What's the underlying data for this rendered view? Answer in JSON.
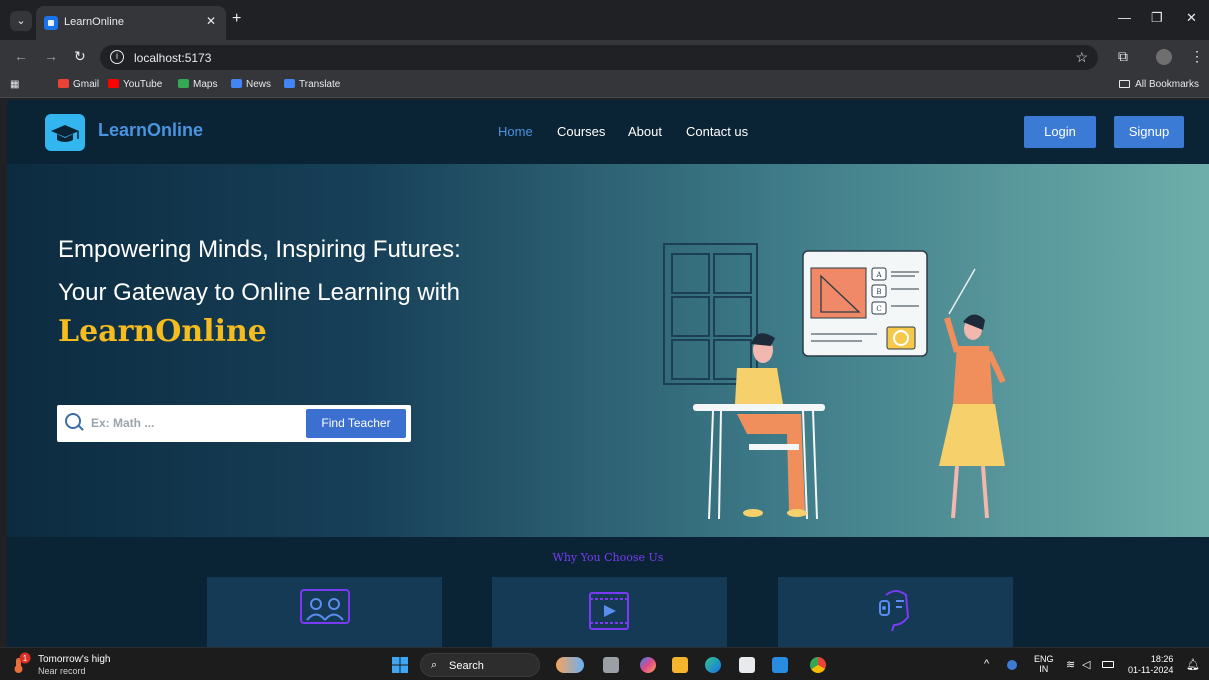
{
  "browser": {
    "tab_title": "LearnOnline",
    "tab_close": "✕",
    "new_tab": "+",
    "url": "localhost:5173",
    "bookmarks": [
      "Gmail",
      "YouTube",
      "Maps",
      "News",
      "Translate"
    ],
    "all_bookmarks": "All Bookmarks"
  },
  "site": {
    "brand": "LearnOnline",
    "nav": [
      "Home",
      "Courses",
      "About",
      "Contact us"
    ],
    "active_nav": "Home",
    "login": "Login",
    "signup": "Signup"
  },
  "hero": {
    "line1": "Empowering Minds, Inspiring Futures:",
    "line2": "Your Gateway to Online Learning with",
    "brand": "LearnOnline",
    "search_placeholder": "Ex: Math ...",
    "find_button": "Find Teacher",
    "board_options": [
      "A",
      "B",
      "C"
    ]
  },
  "why": {
    "title": "Why You Choose Us"
  },
  "taskbar": {
    "weather_line1": "Tomorrow's high",
    "weather_line2": "Near record",
    "weather_badge": "1",
    "search": "Search",
    "lang_line1": "ENG",
    "lang_line2": "IN",
    "time": "18:26",
    "date": "01-11-2024"
  },
  "colors": {
    "nav_bg": "#0a2436",
    "accent_blue": "#3b7bd6",
    "brand_yellow": "#f5bc1f",
    "why_title": "#7a3bf2"
  }
}
